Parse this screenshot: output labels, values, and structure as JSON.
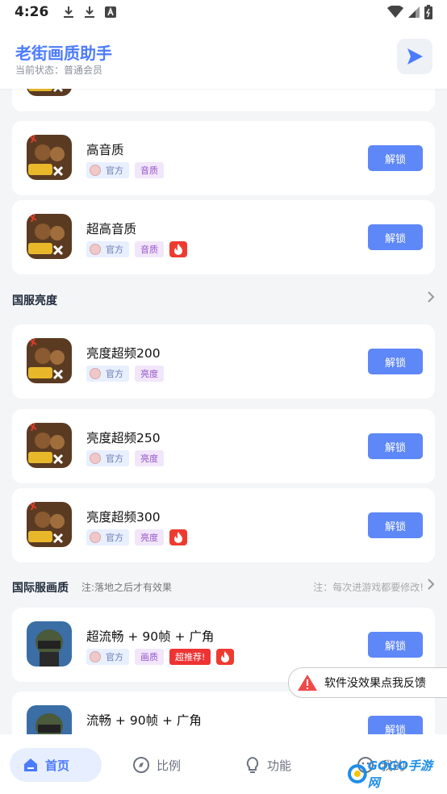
{
  "status_bar": {
    "time": "4:26"
  },
  "header": {
    "title": "老街画质助手",
    "subtitle": "当前状态：普通会员"
  },
  "cards_top": [
    {
      "name": "高音质",
      "official": "官方",
      "kind": "音质",
      "unlock": "解锁",
      "hot": false
    },
    {
      "name": "超高音质",
      "official": "官方",
      "kind": "音质",
      "unlock": "解锁",
      "hot": true
    }
  ],
  "section_cn": {
    "title": "国服亮度"
  },
  "cards_cn": [
    {
      "name": "亮度超频200",
      "official": "官方",
      "kind": "亮度",
      "unlock": "解锁",
      "hot": false
    },
    {
      "name": "亮度超频250",
      "official": "官方",
      "kind": "亮度",
      "unlock": "解锁",
      "hot": false
    },
    {
      "name": "亮度超频300",
      "official": "官方",
      "kind": "亮度",
      "unlock": "解锁",
      "hot": true
    }
  ],
  "section_intl": {
    "title": "国际服画质",
    "note": "注:落地之后才有效果",
    "right_note": "注：每次进游戏都要修改!"
  },
  "cards_intl": [
    {
      "name": "超流畅 + 90帧 + 广角",
      "official": "官方",
      "kind": "画质",
      "recommend": "超推荐!",
      "unlock": "解锁"
    },
    {
      "name": "流畅 + 90帧 + 广角",
      "unlock": "解锁"
    }
  ],
  "feedback": {
    "label": "软件没效果点我反馈"
  },
  "bottom_nav": [
    {
      "label": "首页"
    },
    {
      "label": "比例"
    },
    {
      "label": "功能"
    },
    {
      "label": "我的"
    }
  ],
  "watermark": {
    "text": "GOGO手游网"
  }
}
